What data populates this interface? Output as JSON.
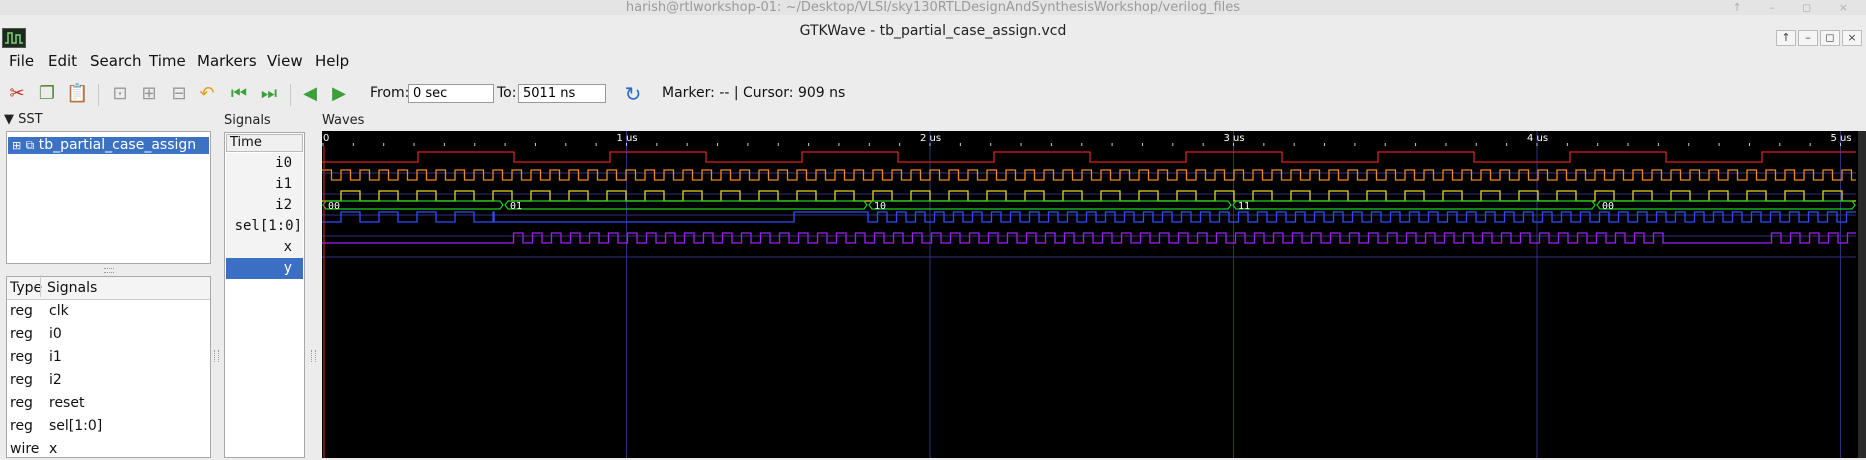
{
  "outer_window": {
    "title": "harish@rtlworkshop-01: ~/Desktop/VLSI/sky130RTLDesignAndSynthesisWorkshop/verilog_files"
  },
  "window": {
    "title": "GTKWave - tb_partial_case_assign.vcd"
  },
  "menu": [
    "File",
    "Edit",
    "Search",
    "Time",
    "Markers",
    "View",
    "Help"
  ],
  "toolbar": {
    "from_label": "From:",
    "from_value": "0 sec",
    "to_label": "To:",
    "to_value": "5011 ns",
    "marker_text": "Marker: --  |  Cursor: 909 ns",
    "icons": [
      "cut-icon",
      "copy-icon",
      "paste-icon",
      "zoom-fit-icon",
      "zoom-in-icon",
      "zoom-out-icon",
      "undo-zoom-icon",
      "zoom-start-icon",
      "zoom-end-icon",
      "prev-edge-icon",
      "next-edge-icon",
      "reload-icon"
    ]
  },
  "sst": {
    "header": "SST",
    "tree_item": "tb_partial_case_assign"
  },
  "signals_table": {
    "col_type": "Type",
    "col_signals": "Signals",
    "rows": [
      {
        "type": "reg",
        "name": "clk"
      },
      {
        "type": "reg",
        "name": "i0"
      },
      {
        "type": "reg",
        "name": "i1"
      },
      {
        "type": "reg",
        "name": "i2"
      },
      {
        "type": "reg",
        "name": "reset"
      },
      {
        "type": "reg",
        "name": "sel[1:0]"
      },
      {
        "type": "wire",
        "name": "x"
      }
    ]
  },
  "signals_panel": {
    "header": "Signals",
    "time_label": "Time",
    "names": [
      "i0",
      "i1",
      "i2",
      "sel[1:0]",
      "x",
      "y"
    ],
    "selected": "y"
  },
  "waves_panel": {
    "header": "Waves",
    "time_ticks": [
      "0",
      "1 us",
      "2 us",
      "3 us",
      "4 us",
      "5 us"
    ],
    "sel_values": [
      "00",
      "01",
      "10",
      "11",
      "00"
    ],
    "colors": {
      "i0": "#e02020",
      "i1": "#f08a1a",
      "i2": "#e8d820",
      "sel": "#1fd01f",
      "x": "#2f4fff",
      "y": "#a020f0",
      "grid": "#303080",
      "bg": "#000000"
    }
  }
}
